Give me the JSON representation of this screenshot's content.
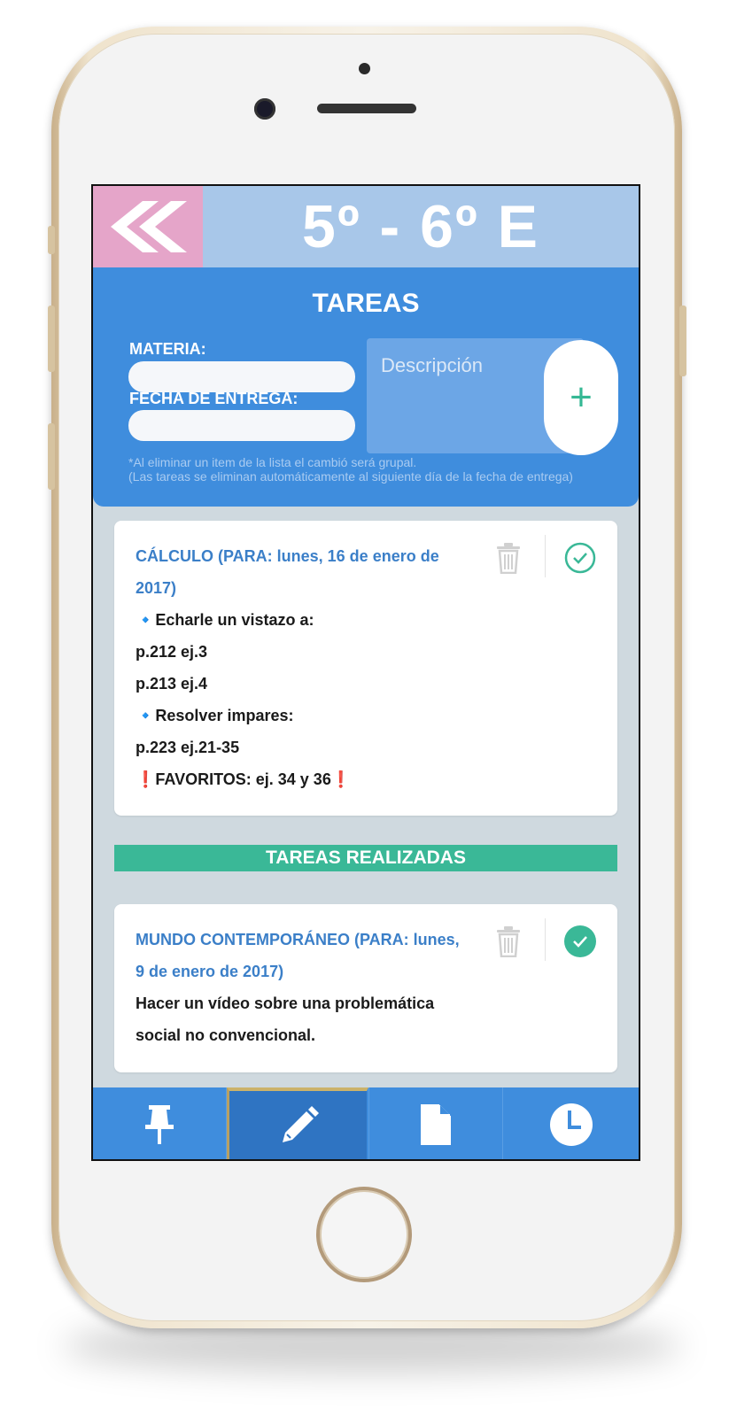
{
  "header": {
    "back_icon": "double-chevron-left-icon",
    "group_title": "5º - 6º E"
  },
  "form": {
    "title": "TAREAS",
    "subject_label": "MATERIA:",
    "subject_value": "",
    "due_label": "FECHA DE ENTREGA:",
    "due_value": "",
    "description_placeholder": "Descripción",
    "add_label": "+",
    "note_line1": "*Al eliminar un item de la lista el cambió será grupal.",
    "note_line2": "(Las tareas se eliminan automáticamente al siguiente día de la fecha de entrega)"
  },
  "pending_tasks": [
    {
      "heading_line1": "CÁLCULO (PARA: lunes, 16 de enero de",
      "heading_line2": "2017)",
      "lines": [
        "🔹Echarle un vistazo a:",
        "p.212 ej.3",
        "p.213 ej.4",
        "🔹Resolver impares:",
        "p.223 ej.21-35",
        "❗FAVORITOS: ej. 34 y 36❗"
      ],
      "done": false
    }
  ],
  "done_section": {
    "label": "TAREAS REALIZADAS"
  },
  "done_tasks": [
    {
      "heading_line1": "MUNDO CONTEMPORÁNEO (PARA: lunes,",
      "heading_line2": "9 de enero de 2017)",
      "lines": [
        "Hacer un vídeo sobre una problemática",
        "social no convencional."
      ],
      "done": true
    }
  ],
  "bottom_nav": {
    "items": [
      "pin-icon",
      "pencil-icon",
      "document-icon",
      "clock-icon"
    ],
    "active": "pencil-icon"
  },
  "colors": {
    "accent_blue": "#3f8ddd",
    "header_light_blue": "#a8c7e9",
    "back_pink": "#e5a5c9",
    "done_green": "#3ab897"
  }
}
